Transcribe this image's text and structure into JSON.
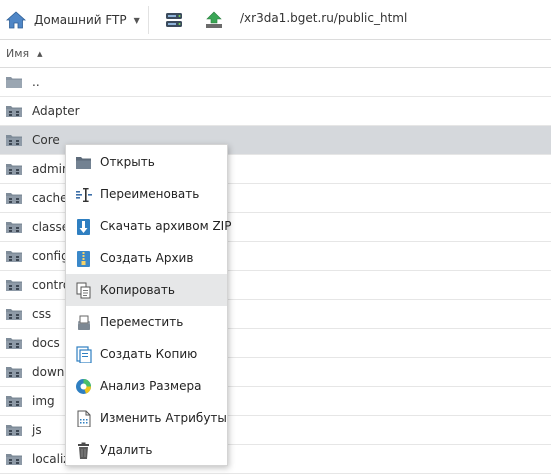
{
  "toolbar": {
    "connection_label": "Домашний FTP",
    "path": "/xr3da1.bget.ru/public_html"
  },
  "list_header": {
    "name_column": "Имя"
  },
  "files": [
    {
      "name": ".."
    },
    {
      "name": "Adapter"
    },
    {
      "name": "Core"
    },
    {
      "name": "admin"
    },
    {
      "name": "cache"
    },
    {
      "name": "classes"
    },
    {
      "name": "config"
    },
    {
      "name": "controllers"
    },
    {
      "name": "css"
    },
    {
      "name": "docs"
    },
    {
      "name": "download"
    },
    {
      "name": "img"
    },
    {
      "name": "js"
    },
    {
      "name": "localization"
    }
  ],
  "selected_file": "Core",
  "context_menu": {
    "items": [
      {
        "label": "Открыть",
        "icon": "folder-open-icon"
      },
      {
        "label": "Переименовать",
        "icon": "rename-icon"
      },
      {
        "label": "Скачать архивом ZIP",
        "icon": "download-zip-icon"
      },
      {
        "label": "Создать Архив",
        "icon": "archive-icon"
      },
      {
        "label": "Копировать",
        "icon": "copy-icon"
      },
      {
        "label": "Переместить",
        "icon": "move-icon"
      },
      {
        "label": "Создать Копию",
        "icon": "duplicate-icon"
      },
      {
        "label": "Анализ Размера",
        "icon": "size-analysis-icon"
      },
      {
        "label": "Изменить Атрибуты",
        "icon": "attributes-icon"
      },
      {
        "label": "Удалить",
        "icon": "trash-icon"
      }
    ],
    "hovered": "Копировать"
  },
  "colors": {
    "selected_row": "#d5d8dc",
    "hover_item": "#e6e7e8",
    "folder": "#7f8c99",
    "accent_blue": "#2f7fc1",
    "upload_green": "#3aa655"
  }
}
